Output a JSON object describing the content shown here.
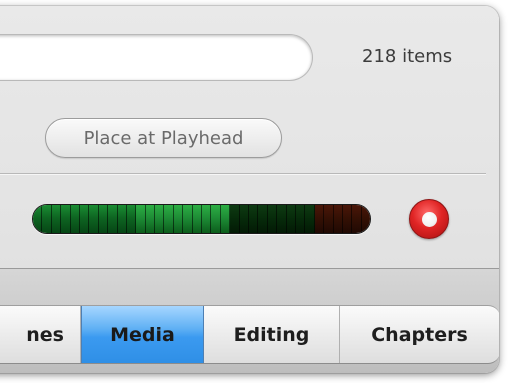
{
  "library": {
    "search_value": "",
    "items_count": "218 items"
  },
  "actions": {
    "place_at_playhead_label": "Place at Playhead"
  },
  "audio": {
    "meter_level": 0.57,
    "meter_segments": 36,
    "record_icon": "record-icon"
  },
  "tabs": [
    {
      "label": "nes",
      "active": false
    },
    {
      "label": "Media",
      "active": true
    },
    {
      "label": "Editing",
      "active": false
    },
    {
      "label": "Chapters",
      "active": false
    }
  ],
  "colors": {
    "active_tab": "#3b9af0",
    "meter_green": "#1b8d33",
    "record_red": "#e02525"
  }
}
